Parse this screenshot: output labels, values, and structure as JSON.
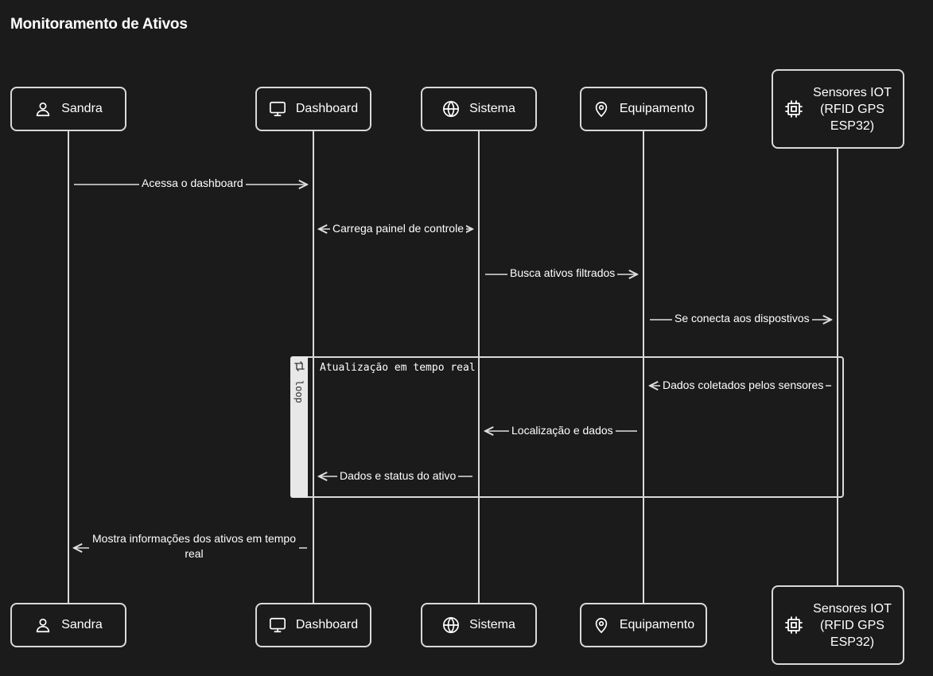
{
  "title": "Monitoramento de Ativos",
  "participants": [
    {
      "label": "Sandra",
      "icon": "user-icon"
    },
    {
      "label": "Dashboard",
      "icon": "monitor-icon"
    },
    {
      "label": "Sistema",
      "icon": "globe-icon"
    },
    {
      "label": "Equipamento",
      "icon": "map-pin-icon"
    },
    {
      "label": "Sensores IOT (RFID GPS ESP32)",
      "icon": "chip-icon"
    }
  ],
  "messages": [
    {
      "text": "Acessa o dashboard",
      "from": "Sandra",
      "to": "Dashboard"
    },
    {
      "text": "Carrega painel de controle",
      "from": "Dashboard",
      "to": "Sistema"
    },
    {
      "text": "Busca ativos filtrados",
      "from": "Sistema",
      "to": "Equipamento"
    },
    {
      "text": "Se conecta aos dispostivos",
      "from": "Equipamento",
      "to": "Sensores IOT (RFID GPS ESP32)"
    },
    {
      "text": "Dados coletados pelos sensores",
      "from": "Sensores IOT (RFID GPS ESP32)",
      "to": "Equipamento"
    },
    {
      "text": "Localização e dados",
      "from": "Equipamento",
      "to": "Sistema"
    },
    {
      "text": "Dados e status do ativo",
      "from": "Sistema",
      "to": "Dashboard"
    },
    {
      "text": "Mostra informações dos ativos em tempo real",
      "from": "Dashboard",
      "to": "Sandra"
    }
  ],
  "loop": {
    "keyword": "loop",
    "label": "Atualização em tempo real",
    "icon": "repeat-icon"
  }
}
